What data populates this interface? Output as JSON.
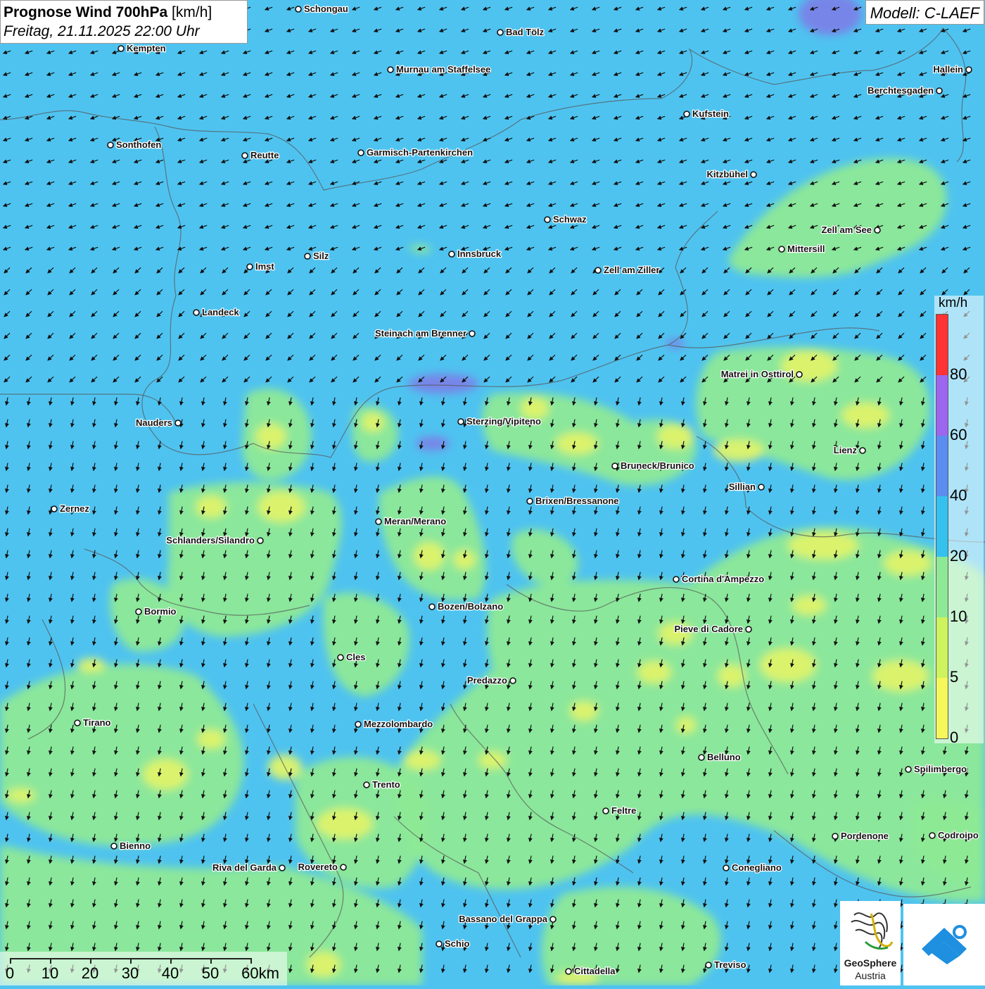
{
  "title": {
    "main_bold": "Prognose Wind 700hPa",
    "main_unit": "[km/h]",
    "datetime": "Freitag, 21.11.2025 22:00 Uhr"
  },
  "model_label": "Modell: C-LAEF",
  "legend": {
    "unit": "km/h",
    "ticks": [
      "80",
      "60",
      "40",
      "20",
      "10",
      "5",
      "0"
    ],
    "colors": [
      "#ff3333",
      "#9d66ee",
      "#5b8df0",
      "#34c1ee",
      "#8ee996",
      "#cdf35e",
      "#f5f75a"
    ]
  },
  "scale_bar": {
    "labels": [
      "0",
      "10",
      "20",
      "30",
      "40",
      "50",
      "60km"
    ]
  },
  "brand": {
    "name_line1": "GeoSphere",
    "name_line2": "Austria"
  },
  "wind_field": {
    "dominant_speed_class": "20",
    "direction": "from north-east"
  },
  "cities": [
    {
      "name": "Schongau"
    },
    {
      "name": "Bad Tölz"
    },
    {
      "name": "Kempten"
    },
    {
      "name": "Murnau am Staffelsee"
    },
    {
      "name": "Hallein"
    },
    {
      "name": "Berchtesgaden"
    },
    {
      "name": "Kufstein"
    },
    {
      "name": "Sonthofen"
    },
    {
      "name": "Reutte"
    },
    {
      "name": "Garmisch-Partenkirchen"
    },
    {
      "name": "Kitzbühel"
    },
    {
      "name": "Schwaz"
    },
    {
      "name": "Zell am See"
    },
    {
      "name": "Mittersill"
    },
    {
      "name": "Innsbruck"
    },
    {
      "name": "Silz"
    },
    {
      "name": "Imst"
    },
    {
      "name": "Zell am Ziller"
    },
    {
      "name": "Landeck"
    },
    {
      "name": "Steinach am Brenner"
    },
    {
      "name": "Matrei in Osttirol"
    },
    {
      "name": "Nauders"
    },
    {
      "name": "Sterzing/Vipiteno"
    },
    {
      "name": "Lienz"
    },
    {
      "name": "Bruneck/Brunico"
    },
    {
      "name": "Sillian"
    },
    {
      "name": "Brixen/Bressanone"
    },
    {
      "name": "Zernez"
    },
    {
      "name": "Meran/Merano"
    },
    {
      "name": "Schlanders/Silandro"
    },
    {
      "name": "Cortina d'Ampezzo"
    },
    {
      "name": "Bozen/Bolzano"
    },
    {
      "name": "Bormio"
    },
    {
      "name": "Pieve di Cadore"
    },
    {
      "name": "Cles"
    },
    {
      "name": "Predazzo"
    },
    {
      "name": "Tirano"
    },
    {
      "name": "Mezzolombardo"
    },
    {
      "name": "Belluno"
    },
    {
      "name": "Spilimbergo"
    },
    {
      "name": "Trento"
    },
    {
      "name": "Feltre"
    },
    {
      "name": "Pordenone"
    },
    {
      "name": "Codroipo"
    },
    {
      "name": "Bienno"
    },
    {
      "name": "Riva del Garda"
    },
    {
      "name": "Rovereto"
    },
    {
      "name": "Conegliano"
    },
    {
      "name": "Bassano del Grappa"
    },
    {
      "name": "Schio"
    },
    {
      "name": "Treviso"
    },
    {
      "name": "Cittadella"
    }
  ]
}
